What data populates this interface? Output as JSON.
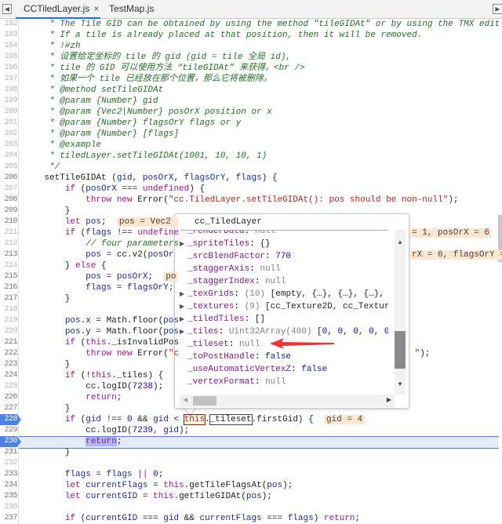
{
  "tabs": [
    {
      "label": "CCTiledLayer.js",
      "close": "×",
      "active": true
    },
    {
      "label": "TestMap.js",
      "active": false
    }
  ],
  "icons": {
    "left_panel": "panel-toggle-left-icon",
    "right_panel": "panel-toggle-right-icon"
  },
  "colors": {
    "accent": "#1a73e8",
    "breakpoint": "#4c82e6",
    "comment": "#236e25",
    "keyword": "#aa0d91",
    "string": "#c41a16",
    "inline_value_bg": "#fde6d0"
  },
  "breakpoints": [
    228,
    230
  ],
  "current_line": 230,
  "code": [
    {
      "n": 192,
      "t": [
        [
          "c",
          "     * The Tile GID can be obtained by using the method \"tileGIDAt\" or by using the TMX edit"
        ]
      ]
    },
    {
      "n": 193,
      "t": [
        [
          "c",
          "     * If a tile is already placed at that position, then it will be removed."
        ]
      ]
    },
    {
      "n": 194,
      "t": [
        [
          "c",
          "     * !#zh"
        ]
      ]
    },
    {
      "n": 195,
      "t": [
        [
          "c",
          "     * 设置给定坐标的 tile 的 gid (gid = tile 全局 id),"
        ]
      ]
    },
    {
      "n": 196,
      "t": [
        [
          "c",
          "     * tile 的 GID 可以使用方法 “tileGIDAt” 来获得。<br />"
        ]
      ]
    },
    {
      "n": 197,
      "t": [
        [
          "c",
          "     * 如果一个 tile 已经放在那个位置，那么它将被删除。"
        ]
      ]
    },
    {
      "n": 198,
      "t": [
        [
          "c",
          "     * @method setTileGIDAt"
        ]
      ]
    },
    {
      "n": 199,
      "t": [
        [
          "c",
          "     * @param {Number} gid"
        ]
      ]
    },
    {
      "n": 200,
      "t": [
        [
          "c",
          "     * @param {Vec2|Number} posOrX position or x"
        ]
      ]
    },
    {
      "n": 201,
      "t": [
        [
          "c",
          "     * @param {Number} flagsOrY flags or y"
        ]
      ]
    },
    {
      "n": 202,
      "t": [
        [
          "c",
          "     * @param {Number} [flags]"
        ]
      ]
    },
    {
      "n": 203,
      "t": [
        [
          "c",
          "     * @example"
        ]
      ]
    },
    {
      "n": 204,
      "t": [
        [
          "c",
          "     * tiledLayer.setTileGIDAt(1001, 10, 10, 1)"
        ]
      ]
    },
    {
      "n": 205,
      "t": [
        [
          "c",
          "     */"
        ]
      ]
    },
    {
      "n": 206,
      "dark": true,
      "t": [
        [
          "p",
          "    setTileGIDAt ("
        ],
        [
          "v",
          "gid"
        ],
        [
          "p",
          ", "
        ],
        [
          "v",
          "posOrX"
        ],
        [
          "p",
          ", "
        ],
        [
          "v",
          "flagsOrY"
        ],
        [
          "p",
          ", "
        ],
        [
          "v",
          "flags"
        ],
        [
          "p",
          ") {"
        ]
      ]
    },
    {
      "n": 207,
      "t": [
        [
          "p",
          "        "
        ],
        [
          "k",
          "if"
        ],
        [
          "p",
          " ("
        ],
        [
          "v",
          "posOrX"
        ],
        [
          "p",
          " === "
        ],
        [
          "k",
          "undefined"
        ],
        [
          "p",
          ") {"
        ]
      ]
    },
    {
      "n": 208,
      "dark": true,
      "t": [
        [
          "p",
          "            "
        ],
        [
          "k",
          "throw new"
        ],
        [
          "p",
          " Error("
        ],
        [
          "s",
          "\"cc.TiledLayer.setTileGIDAt(): pos should be non-null\""
        ],
        [
          "p",
          ");"
        ]
      ]
    },
    {
      "n": 209,
      "dark": true,
      "t": [
        [
          "p",
          "        }"
        ]
      ]
    },
    {
      "n": 210,
      "dark": true,
      "t": [
        [
          "p",
          "        "
        ],
        [
          "k",
          "let"
        ],
        [
          "p",
          " "
        ],
        [
          "v",
          "pos"
        ],
        [
          "p",
          ";  "
        ],
        [
          "i",
          "pos = Vec2 "
        ]
      ]
    },
    {
      "n": 211,
      "t": [
        [
          "p",
          "        "
        ],
        [
          "k",
          "if"
        ],
        [
          "p",
          " ("
        ],
        [
          "v",
          "flags"
        ],
        [
          "p",
          " !== "
        ],
        [
          "k",
          "undefine"
        ]
      ],
      "right": [
        [
          "i",
          "= 1, posOrX = 6"
        ]
      ]
    },
    {
      "n": 212,
      "t": [
        [
          "p",
          "            "
        ],
        [
          "c",
          "// four parameters"
        ]
      ]
    },
    {
      "n": 213,
      "dark": true,
      "t": [
        [
          "p",
          "            "
        ],
        [
          "v",
          "pos"
        ],
        [
          "p",
          " = cc.v2("
        ],
        [
          "v",
          "posOr"
        ]
      ],
      "right": [
        [
          "i",
          "rX = 6, flagsOrY = "
        ]
      ]
    },
    {
      "n": 214,
      "t": [
        [
          "p",
          "        } "
        ],
        [
          "k",
          "else"
        ],
        [
          "p",
          " {"
        ]
      ]
    },
    {
      "n": 215,
      "dark": true,
      "t": [
        [
          "p",
          "            "
        ],
        [
          "v",
          "pos"
        ],
        [
          "p",
          " = "
        ],
        [
          "v",
          "posOrX"
        ],
        [
          "p",
          ";  "
        ],
        [
          "i",
          "po"
        ]
      ]
    },
    {
      "n": 216,
      "dark": true,
      "t": [
        [
          "p",
          "            "
        ],
        [
          "v",
          "flags"
        ],
        [
          "p",
          " = "
        ],
        [
          "v",
          "flagsOrY"
        ],
        [
          "p",
          ";"
        ]
      ]
    },
    {
      "n": 217,
      "dark": true,
      "t": [
        [
          "p",
          "        }"
        ]
      ]
    },
    {
      "n": 218,
      "t": []
    },
    {
      "n": 219,
      "t": [
        [
          "p",
          "        "
        ],
        [
          "v",
          "pos"
        ],
        [
          "p",
          ".x = Math.floor("
        ],
        [
          "v",
          "pos"
        ]
      ]
    },
    {
      "n": 220,
      "t": [
        [
          "p",
          "        "
        ],
        [
          "v",
          "pos"
        ],
        [
          "p",
          ".y = Math.floor("
        ],
        [
          "v",
          "pos"
        ]
      ]
    },
    {
      "n": 221,
      "dark": true,
      "t": [
        [
          "p",
          "        "
        ],
        [
          "k",
          "if"
        ],
        [
          "p",
          " ("
        ],
        [
          "k",
          "this"
        ],
        [
          "p",
          "._isInvalidPos"
        ]
      ]
    },
    {
      "n": 222,
      "dark": true,
      "t": [
        [
          "p",
          "            "
        ],
        [
          "k",
          "throw new"
        ],
        [
          "p",
          " Error("
        ],
        [
          "s",
          "\"c"
        ]
      ],
      "right": [
        [
          "s",
          " \""
        ],
        [
          "p",
          ");"
        ]
      ]
    },
    {
      "n": 223,
      "dark": true,
      "t": [
        [
          "p",
          "        }"
        ]
      ]
    },
    {
      "n": 224,
      "dark": true,
      "t": [
        [
          "p",
          "        "
        ],
        [
          "k",
          "if"
        ],
        [
          "p",
          " (!"
        ],
        [
          "k",
          "this"
        ],
        [
          "p",
          "._tiles) {"
        ]
      ]
    },
    {
      "n": 225,
      "t": [
        [
          "p",
          "            cc.logID("
        ],
        [
          "n",
          "7238"
        ],
        [
          "p",
          ");"
        ]
      ]
    },
    {
      "n": 226,
      "dark": true,
      "t": [
        [
          "p",
          "            "
        ],
        [
          "k",
          "return"
        ],
        [
          "p",
          ";"
        ]
      ]
    },
    {
      "n": 227,
      "dark": true,
      "t": [
        [
          "p",
          "        }"
        ]
      ]
    },
    {
      "n": 228,
      "t": [
        [
          "p",
          "        "
        ],
        [
          "k",
          "if"
        ],
        [
          "p",
          " ("
        ],
        [
          "v",
          "gid"
        ],
        [
          "p",
          " !== "
        ],
        [
          "n",
          "0"
        ],
        [
          "p",
          " && "
        ],
        [
          "v",
          "gid"
        ],
        [
          "p",
          " < "
        ],
        [
          "k boxr",
          "this"
        ],
        [
          "p",
          "."
        ],
        [
          "p box",
          "_tileset"
        ],
        [
          "p",
          ".firstGid) {  "
        ],
        [
          "i",
          "gid = 4"
        ]
      ]
    },
    {
      "n": 229,
      "dark": true,
      "t": [
        [
          "p",
          "            cc.logID("
        ],
        [
          "n",
          "7239"
        ],
        [
          "p",
          ", "
        ],
        [
          "v",
          "gid"
        ],
        [
          "p",
          ");"
        ]
      ]
    },
    {
      "n": 230,
      "t": [
        [
          "p",
          "            "
        ],
        [
          "k sel",
          "return"
        ],
        [
          "p",
          ";"
        ]
      ]
    },
    {
      "n": 231,
      "dark": true,
      "t": [
        [
          "p",
          "        }"
        ]
      ]
    },
    {
      "n": 232,
      "t": []
    },
    {
      "n": 233,
      "dark": true,
      "t": [
        [
          "p",
          "        "
        ],
        [
          "v",
          "flags"
        ],
        [
          "p",
          " = "
        ],
        [
          "v",
          "flags"
        ],
        [
          "p",
          " "
        ],
        [
          "k",
          "||"
        ],
        [
          "p",
          " "
        ],
        [
          "n",
          "0"
        ],
        [
          "p",
          ";"
        ]
      ]
    },
    {
      "n": 234,
      "dark": true,
      "t": [
        [
          "p",
          "        "
        ],
        [
          "k",
          "let"
        ],
        [
          "p",
          " "
        ],
        [
          "v",
          "currentFlags"
        ],
        [
          "p",
          " = "
        ],
        [
          "k",
          "this"
        ],
        [
          "p",
          ".getTileFlagsAt("
        ],
        [
          "v",
          "pos"
        ],
        [
          "p",
          ");"
        ]
      ]
    },
    {
      "n": 235,
      "dark": true,
      "t": [
        [
          "p",
          "        "
        ],
        [
          "k",
          "let"
        ],
        [
          "p",
          " "
        ],
        [
          "v",
          "currentGID"
        ],
        [
          "p",
          " = "
        ],
        [
          "k",
          "this"
        ],
        [
          "p",
          ".getTileGIDAt("
        ],
        [
          "v",
          "pos"
        ],
        [
          "p",
          ");"
        ]
      ]
    },
    {
      "n": 236,
      "t": []
    },
    {
      "n": 237,
      "dark": true,
      "t": [
        [
          "p",
          "        "
        ],
        [
          "k",
          "if"
        ],
        [
          "p",
          " ("
        ],
        [
          "v",
          "currentGID"
        ],
        [
          "p",
          " === "
        ],
        [
          "v",
          "gid"
        ],
        [
          "p",
          " && "
        ],
        [
          "v",
          "currentFlags"
        ],
        [
          "p",
          " === "
        ],
        [
          "v",
          "flags"
        ],
        [
          "p",
          ") "
        ],
        [
          "k",
          "return"
        ],
        [
          "p",
          ";"
        ]
      ]
    }
  ],
  "popup": {
    "title": "cc_TiledLayer",
    "items": [
      {
        "name": "_renderData",
        "value": [
          [
            "pnull",
            "null"
          ]
        ]
      },
      {
        "name": "_spriteTiles",
        "expandable": true,
        "value": [
          [
            "p",
            "{}"
          ]
        ]
      },
      {
        "name": "_srcBlendFactor",
        "value": [
          [
            "pnum",
            "770"
          ]
        ]
      },
      {
        "name": "_staggerAxis",
        "value": [
          [
            "pnull",
            "null"
          ]
        ]
      },
      {
        "name": "_staggerIndex",
        "value": [
          [
            "pnull",
            "null"
          ]
        ]
      },
      {
        "name": "_texGrids",
        "expandable": true,
        "value": [
          [
            "pgray",
            "(10) "
          ],
          [
            "p",
            "[empty, {…}, {…}, {…}, {"
          ]
        ]
      },
      {
        "name": "_textures",
        "expandable": true,
        "value": [
          [
            "pgray",
            "(9) "
          ],
          [
            "p",
            "[cc_Texture2D, cc_Texture"
          ]
        ]
      },
      {
        "name": "_tiledTiles",
        "expandable": true,
        "value": [
          [
            "p",
            "[]"
          ]
        ]
      },
      {
        "name": "_tiles",
        "expandable": true,
        "value": [
          [
            "pgray",
            "Uint32Array(400) "
          ],
          [
            "p",
            "["
          ],
          [
            "pnum",
            "0"
          ],
          [
            "p",
            ", "
          ],
          [
            "pnum",
            "0"
          ],
          [
            "p",
            ", "
          ],
          [
            "pnum",
            "0"
          ],
          [
            "p",
            ", "
          ],
          [
            "pnum",
            "0"
          ],
          [
            "p",
            ", "
          ],
          [
            "pnum",
            "0"
          ],
          [
            "p",
            ","
          ]
        ]
      },
      {
        "name": "_tileset",
        "value": [
          [
            "pnull",
            "null"
          ]
        ],
        "annotated": true
      },
      {
        "name": "_toPostHandle",
        "value": [
          [
            "pbool",
            "false"
          ]
        ]
      },
      {
        "name": "_useAutomaticVertexZ",
        "value": [
          [
            "pbool",
            "false"
          ]
        ]
      },
      {
        "name": "_vertexFormat",
        "value": [
          [
            "pnull",
            "null"
          ]
        ]
      }
    ]
  }
}
